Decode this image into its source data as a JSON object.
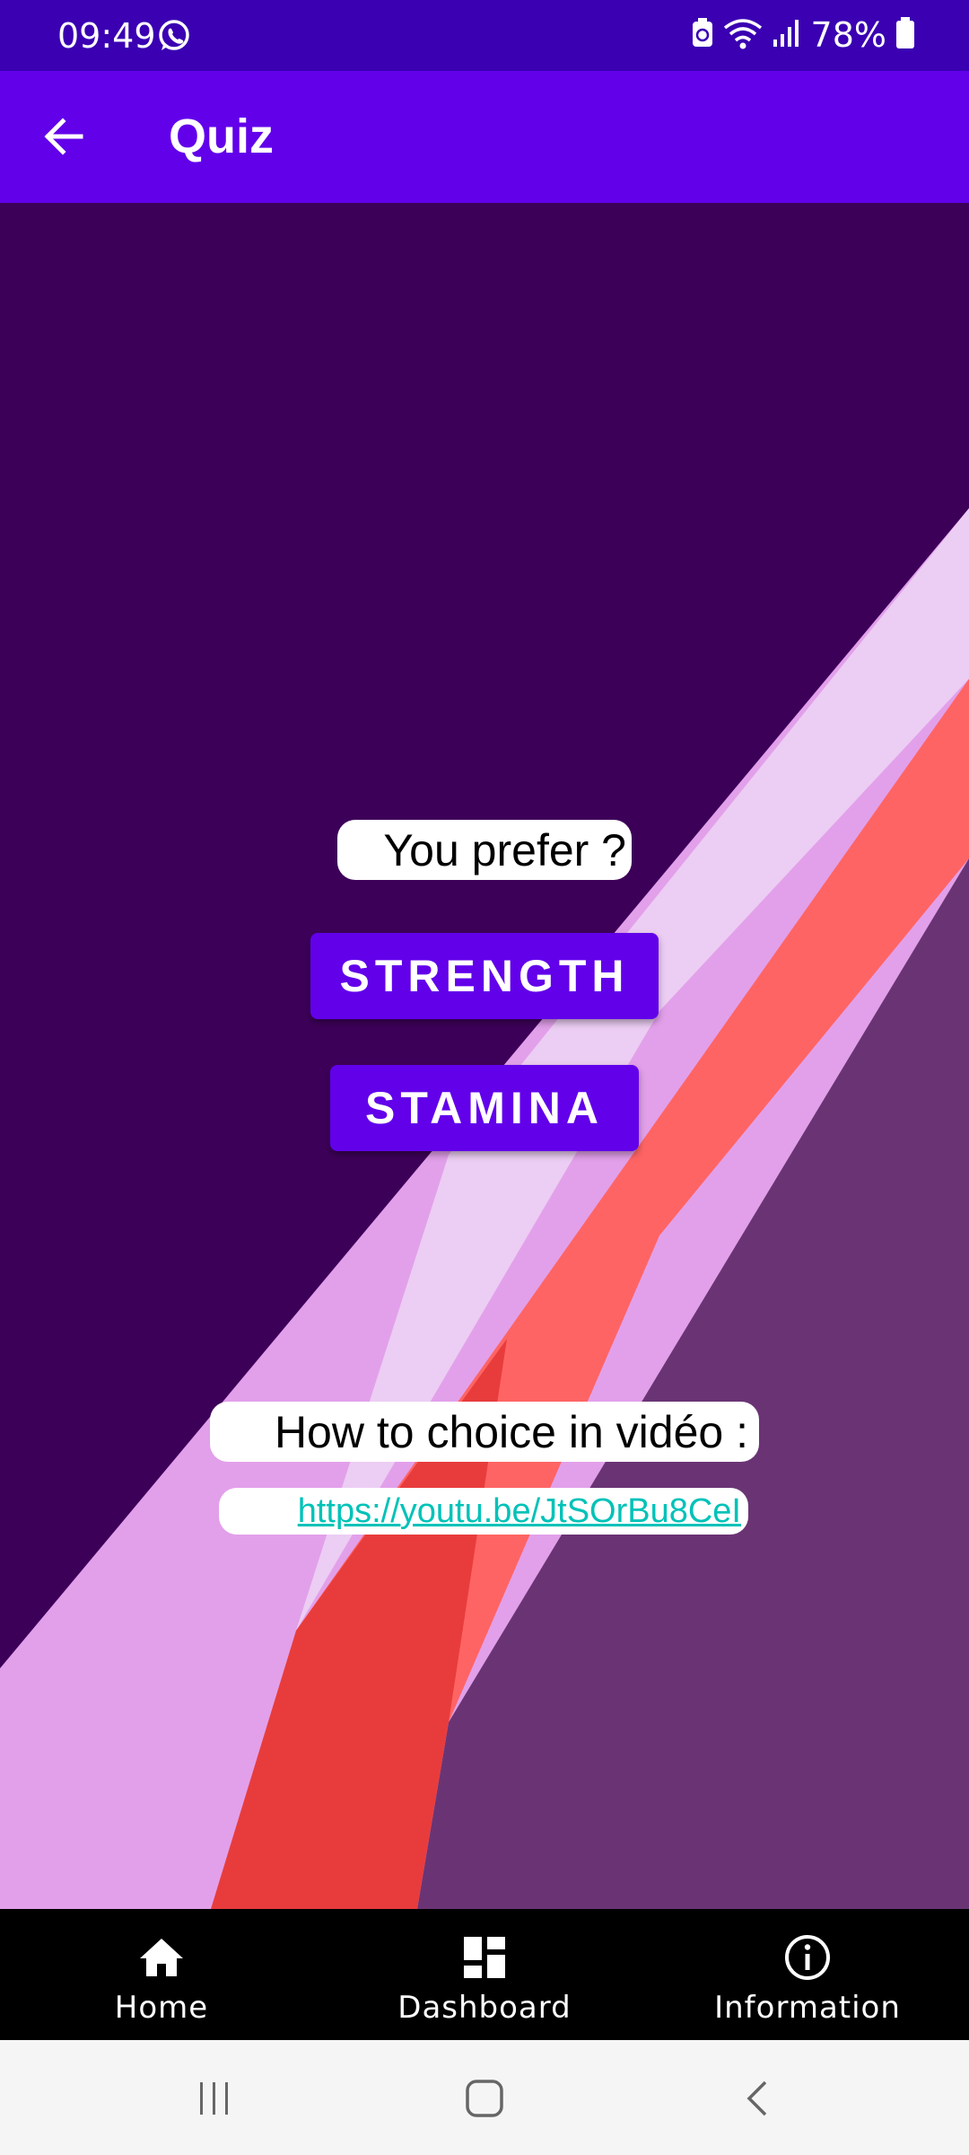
{
  "status_bar": {
    "time": "09:49",
    "battery": "78%",
    "whatsapp_icon": "whatsapp-icon",
    "wifi_icon": "wifi-icon",
    "signal_icon": "signal-icon",
    "battery_icon": "battery-icon"
  },
  "app_bar": {
    "title": "Quiz",
    "back_icon": "arrow-back-icon"
  },
  "quiz": {
    "question": "You prefer ?",
    "options": [
      "STRENGTH",
      "STAMINA"
    ],
    "howto_label": "How to choice in vidéo :",
    "video_link": "https://youtu.be/JtSOrBu8CeI"
  },
  "bottom_nav": {
    "items": [
      {
        "label": "Home",
        "icon": "home-icon"
      },
      {
        "label": "Dashboard",
        "icon": "dashboard-icon"
      },
      {
        "label": "Information",
        "icon": "info-icon"
      }
    ]
  },
  "colors": {
    "status_bar": "#3a00b2",
    "app_bar": "#6200ea",
    "background": "#3d0059",
    "button": "#6200ea",
    "link": "#00c2b8",
    "bottom_nav": "#000000"
  }
}
